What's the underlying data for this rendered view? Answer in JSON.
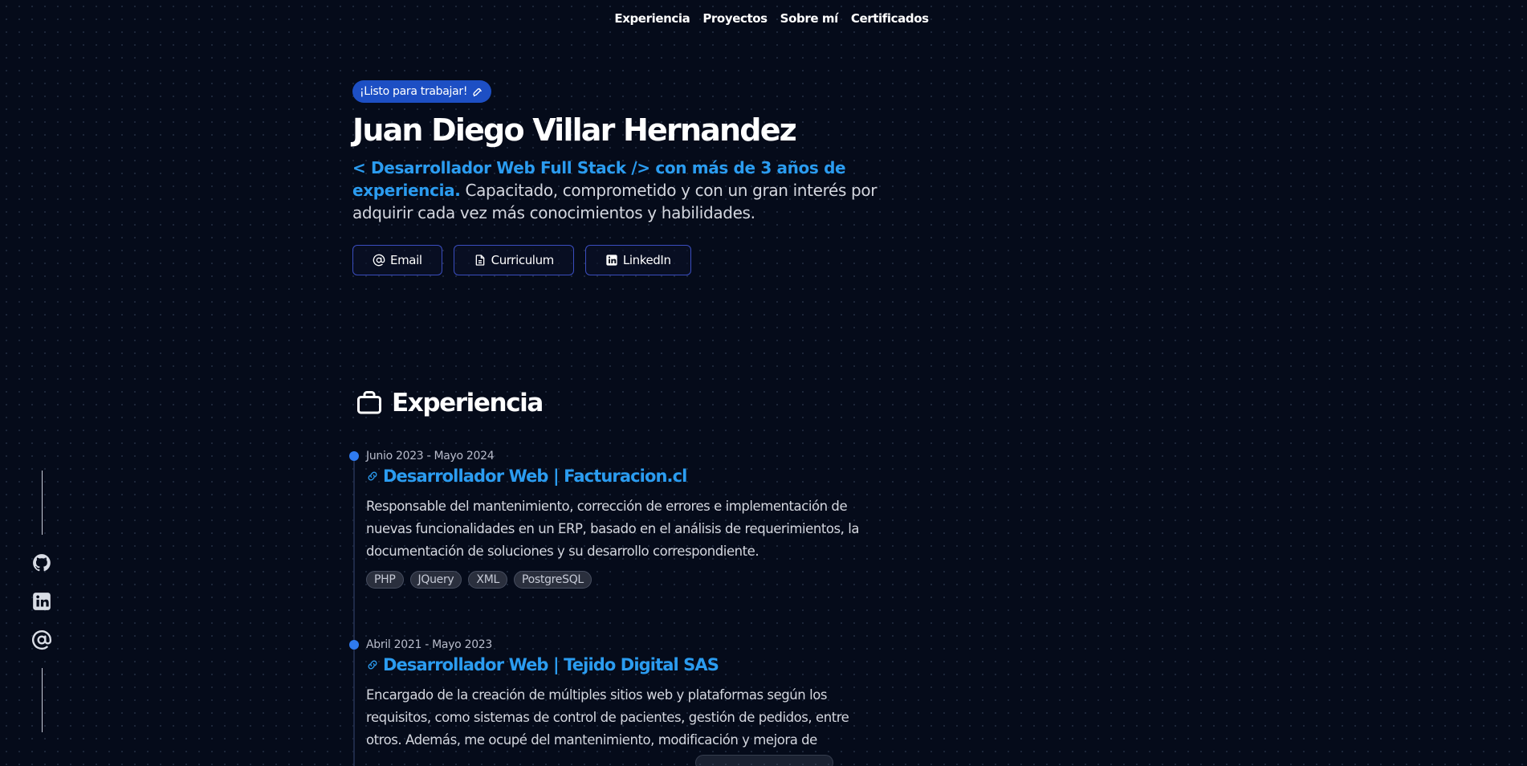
{
  "nav": {
    "items": [
      {
        "label": "Experiencia"
      },
      {
        "label": "Proyectos"
      },
      {
        "label": "Sobre mí"
      },
      {
        "label": "Certificados"
      }
    ]
  },
  "hero": {
    "badge": "¡Listo para trabajar!",
    "badge_icon": "rocket-icon",
    "name": "Juan Diego Villar Hernandez",
    "intro_highlight": "< Desarrollador Web Full Stack /> con más de 3 años de experiencia.",
    "intro_rest": " Capacitado, comprometido y con un gran interés por adquirir cada vez más conocimientos y habilidades.",
    "buttons": [
      {
        "label": "Email",
        "icon": "at-icon"
      },
      {
        "label": "Curriculum",
        "icon": "document-icon"
      },
      {
        "label": "LinkedIn",
        "icon": "linkedin-icon"
      }
    ]
  },
  "experience": {
    "title": "Experiencia",
    "icon": "briefcase-icon",
    "jobs": [
      {
        "date": "Junio 2023 - Mayo 2024",
        "role": "Desarrollador Web | Facturacion.cl",
        "description": "Responsable del mantenimiento, corrección de errores e implementación de nuevas funcionalidades en un ERP, basado en el análisis de requerimientos, la documentación de soluciones y su desarrollo correspondiente.",
        "tags": [
          "PHP",
          "JQuery",
          "XML",
          "PostgreSQL"
        ]
      },
      {
        "date": "Abril 2021 - Mayo 2023",
        "role": "Desarrollador Web | Tejido Digital SAS",
        "description": "Encargado de la creación de múltiples sitios web y plataformas según los requisitos, como sistemas de control de pacientes, gestión de pedidos, entre otros. Además, me ocupé del mantenimiento, modificación y mejora de",
        "tags": []
      }
    ]
  },
  "social": {
    "icons": [
      "github-icon",
      "linkedin-icon",
      "at-icon"
    ]
  },
  "colors": {
    "background": "#050b1a",
    "accent": "#2b9cf0",
    "badge": "#1d4fc4",
    "button_border": "#3a4dbf"
  }
}
